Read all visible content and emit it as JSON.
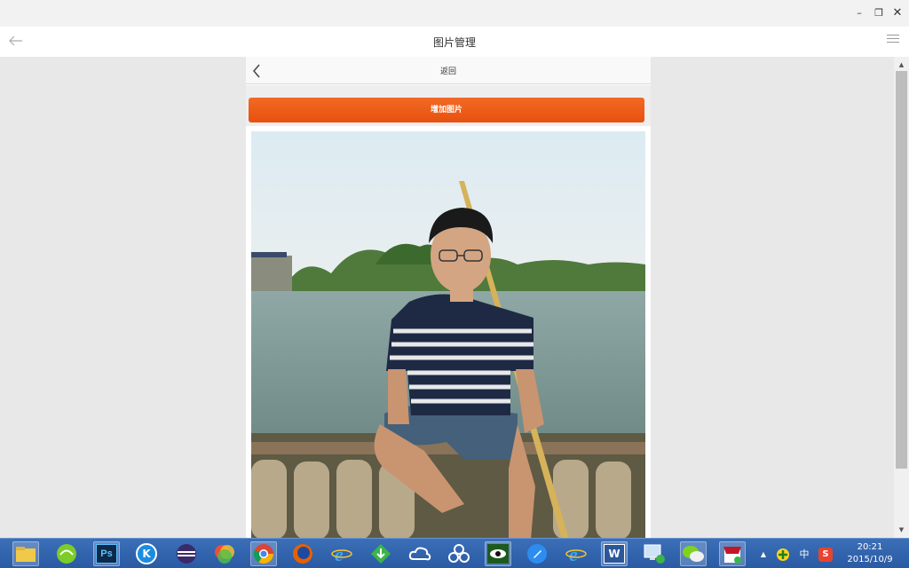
{
  "window": {
    "minimize": "–",
    "restore": "❐",
    "close": "✕"
  },
  "app": {
    "title": "图片管理"
  },
  "page": {
    "title": "返回",
    "add_button_label": "增加图片"
  },
  "photo": {
    "description_icon": "photo-thumbnail"
  },
  "taskbar": {
    "apps": [
      "file-explorer-icon",
      "green-app-icon",
      "photoshop-icon",
      "kugou-icon",
      "eclipse-icon",
      "color-app-icon",
      "chrome-icon",
      "firefox-icon",
      "ie-icon",
      "download-app-icon",
      "cloud-icon",
      "network-app-icon",
      "eye-app-icon",
      "pen-app-icon",
      "ie-icon-2",
      "word-icon",
      "computer-icon",
      "wechat-icon",
      "store-icon"
    ],
    "photoshop_label": "Ps",
    "kugou_label": "K",
    "word_label": "W",
    "tray": {
      "expand": "▲",
      "ime_lang": "中",
      "sogou": "S"
    },
    "time": "20:21",
    "date": "2015/10/9"
  },
  "colors": {
    "accent": "#e8500e",
    "taskbar": "#2a5aa3"
  }
}
